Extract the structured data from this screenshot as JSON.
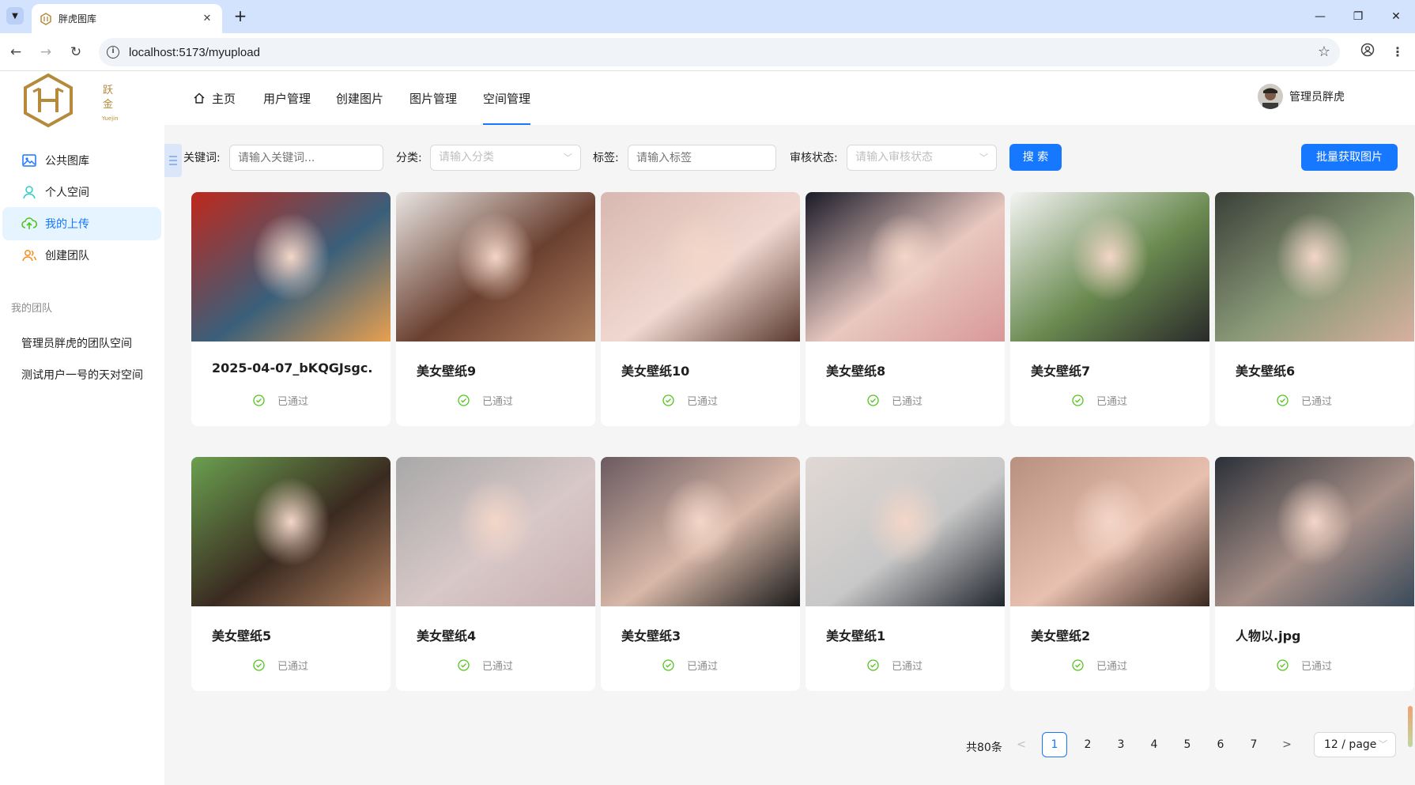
{
  "browser": {
    "tab_title": "胖虎图库",
    "url": "localhost:5173/myupload",
    "new_tab": "+",
    "tab_close": "✕"
  },
  "logo": {
    "text": "跃金",
    "sub": "Yuejin"
  },
  "sidebar": {
    "items": [
      {
        "label": "公共图库",
        "icon": "image-icon"
      },
      {
        "label": "个人空间",
        "icon": "user-icon"
      },
      {
        "label": "我的上传",
        "icon": "cloud-upload-icon",
        "active": true
      },
      {
        "label": "创建团队",
        "icon": "team-icon"
      }
    ],
    "group_title": "我的团队",
    "teams": [
      "管理员胖虎的团队空间",
      "测试用户一号的天对空间"
    ]
  },
  "header": {
    "nav": [
      {
        "label": "主页",
        "icon": "home-icon"
      },
      {
        "label": "用户管理"
      },
      {
        "label": "创建图片"
      },
      {
        "label": "图片管理"
      },
      {
        "label": "空间管理",
        "active": true
      }
    ],
    "user_name": "管理员胖虎"
  },
  "filters": {
    "keyword_label": "关键词:",
    "keyword_placeholder": "请输入关键词...",
    "category_label": "分类:",
    "category_placeholder": "请输入分类",
    "tag_label": "标签:",
    "tag_placeholder": "请输入标签",
    "review_label": "审核状态:",
    "review_placeholder": "请输入审核状态",
    "search_button": "搜 索",
    "batch_button": "批量获取图片"
  },
  "cards": [
    {
      "title": "2025-04-07_bKQGJsgc.",
      "status": "已通过",
      "colors": [
        "#c0281c",
        "#e8a050",
        "#3a5f7a"
      ]
    },
    {
      "title": "美女壁纸9",
      "status": "已通过",
      "colors": [
        "#e8e4e2",
        "#b08060",
        "#6a4030"
      ]
    },
    {
      "title": "美女壁纸10",
      "status": "已通过",
      "colors": [
        "#d8b8b0",
        "#5a3a30",
        "#f0d8d0"
      ]
    },
    {
      "title": "美女壁纸8",
      "status": "已通过",
      "colors": [
        "#1a1a28",
        "#d89898",
        "#e8c8c0"
      ]
    },
    {
      "title": "美女壁纸7",
      "status": "已通过",
      "colors": [
        "#f4f4f4",
        "#2a2a2a",
        "#6a8a50"
      ]
    },
    {
      "title": "美女壁纸6",
      "status": "已通过",
      "colors": [
        "#3a3f38",
        "#d8b0a0",
        "#8a9a78"
      ]
    },
    {
      "title": "美女壁纸5",
      "status": "已通过",
      "colors": [
        "#6aa050",
        "#b08060",
        "#3a2a20"
      ]
    },
    {
      "title": "美女壁纸4",
      "status": "已通过",
      "colors": [
        "#a8a8a8",
        "#c8b0b0",
        "#d8c8c8"
      ]
    },
    {
      "title": "美女壁纸3",
      "status": "已通过",
      "colors": [
        "#6a5a60",
        "#1a1a1a",
        "#d8b8a8"
      ]
    },
    {
      "title": "美女壁纸1",
      "status": "已通过",
      "colors": [
        "#e0d8d4",
        "#20242c",
        "#c8c8c8"
      ]
    },
    {
      "title": "美女壁纸2",
      "status": "已通过",
      "colors": [
        "#b89080",
        "#3a2820",
        "#e8c0b0"
      ]
    },
    {
      "title": "人物以.jpg",
      "status": "已通过",
      "colors": [
        "#2a3038",
        "#3a4a5a",
        "#a89088"
      ]
    }
  ],
  "pagination": {
    "total": "共80条",
    "pages": [
      "1",
      "2",
      "3",
      "4",
      "5",
      "6",
      "7"
    ],
    "current": "1",
    "prev": "<",
    "next": ">",
    "page_size": "12 / page"
  },
  "colors": {
    "accent": "#1677ff",
    "success": "#52c41a",
    "active_bg": "#e6f4ff"
  }
}
